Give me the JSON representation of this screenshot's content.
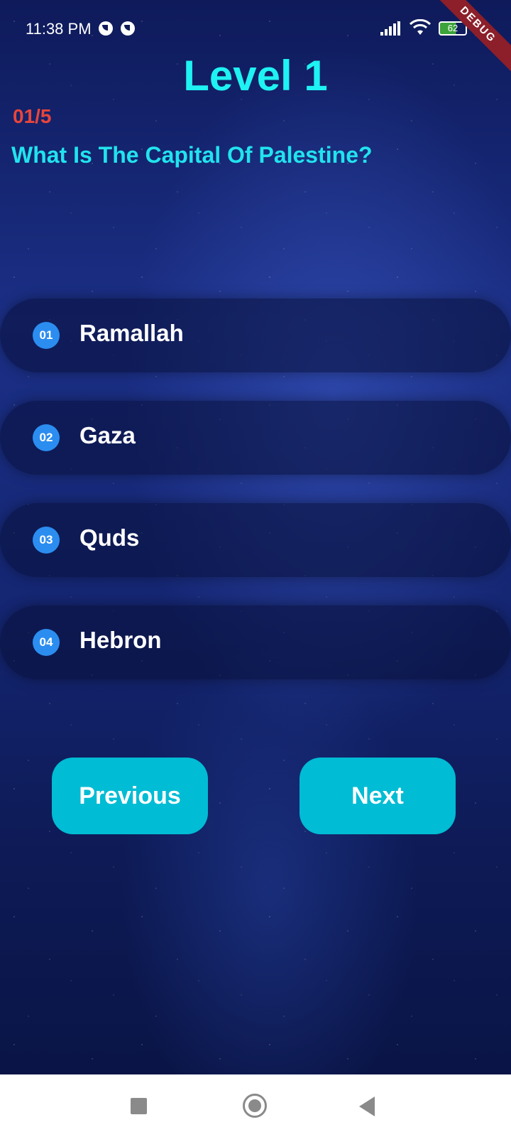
{
  "status_bar": {
    "time": "11:38 PM",
    "battery": "62",
    "debug_label": "DEBUG"
  },
  "header": {
    "level_title": "Level 1",
    "progress": "01/5",
    "question": "What Is The Capital Of Palestine?"
  },
  "options": [
    {
      "number": "01",
      "label": "Ramallah"
    },
    {
      "number": "02",
      "label": "Gaza"
    },
    {
      "number": "03",
      "label": "Quds"
    },
    {
      "number": "04",
      "label": "Hebron"
    }
  ],
  "buttons": {
    "previous_label": "Previous",
    "next_label": "Next"
  },
  "colors": {
    "title": "#1ef2f2",
    "progress": "#e8453c",
    "question": "#21e3ee",
    "option_number_bg": "#2b8df0",
    "button_bg": "#00bcd4"
  },
  "icons": {
    "status": [
      "notification-icon",
      "notification-icon",
      "signal-icon",
      "wifi-icon",
      "battery-icon"
    ],
    "navigation": [
      "recents-icon",
      "home-icon",
      "back-icon"
    ]
  }
}
